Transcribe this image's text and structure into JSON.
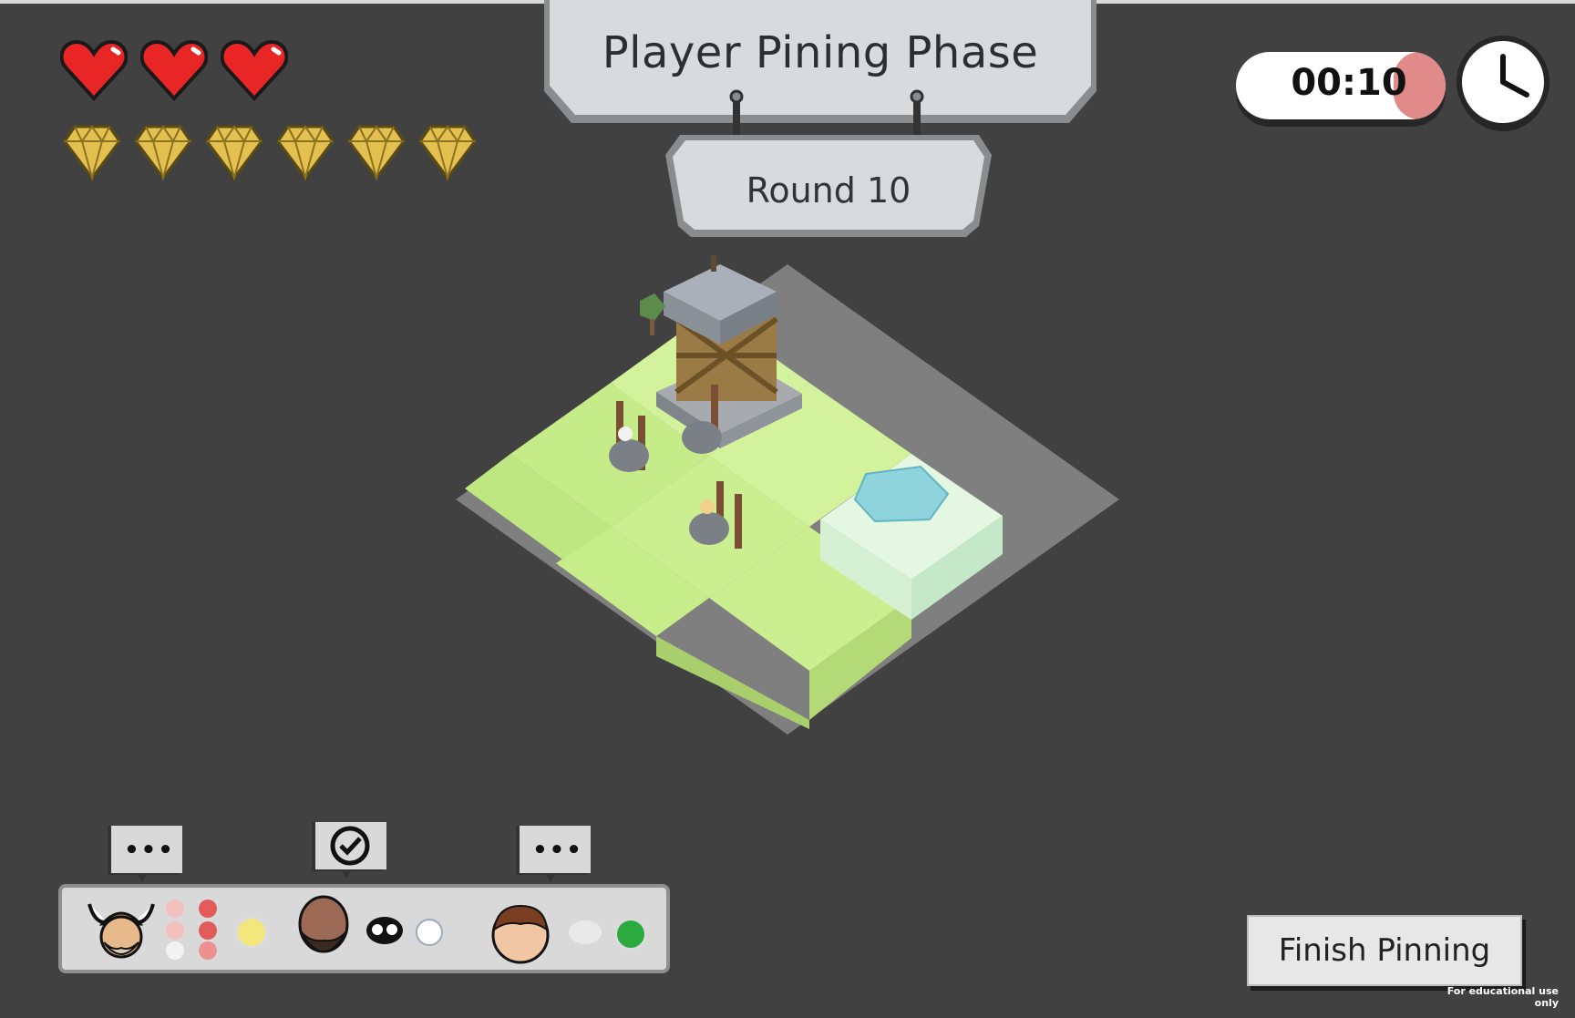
{
  "hud": {
    "lives": 3,
    "gems": 6
  },
  "phase": {
    "title": "Player Pining Phase",
    "round": "Round 10"
  },
  "timer": {
    "time": "00:10",
    "remaining_fraction": 0.25,
    "fill_color": "#e08a8a"
  },
  "board": {
    "tiles_icon": "grass-tile-icon",
    "tower_icon": "watchtower-icon",
    "crystal_icon": "crystal-tile-icon"
  },
  "players": [
    {
      "name_icon": "viking-avatar-icon",
      "status": "thinking",
      "bubble_text": "•••",
      "skulls": 6,
      "dot_color": "#f2e67a"
    },
    {
      "name_icon": "bearded-man-avatar-icon",
      "status": "ready",
      "bubble_text": "",
      "skulls": 1,
      "dot_color": "#ffffff"
    },
    {
      "name_icon": "brown-hair-avatar-icon",
      "status": "thinking",
      "bubble_text": "•••",
      "skulls": 1,
      "dot_color": "#2daa3f"
    }
  ],
  "actions": {
    "finish_label": "Finish Pinning",
    "edu_note": "For educational use only"
  },
  "colors": {
    "background": "#414141",
    "heart": "#e82626",
    "gem": "#e3c04f",
    "grass": "#c9ef8a",
    "plaque": "#d9dadb"
  }
}
